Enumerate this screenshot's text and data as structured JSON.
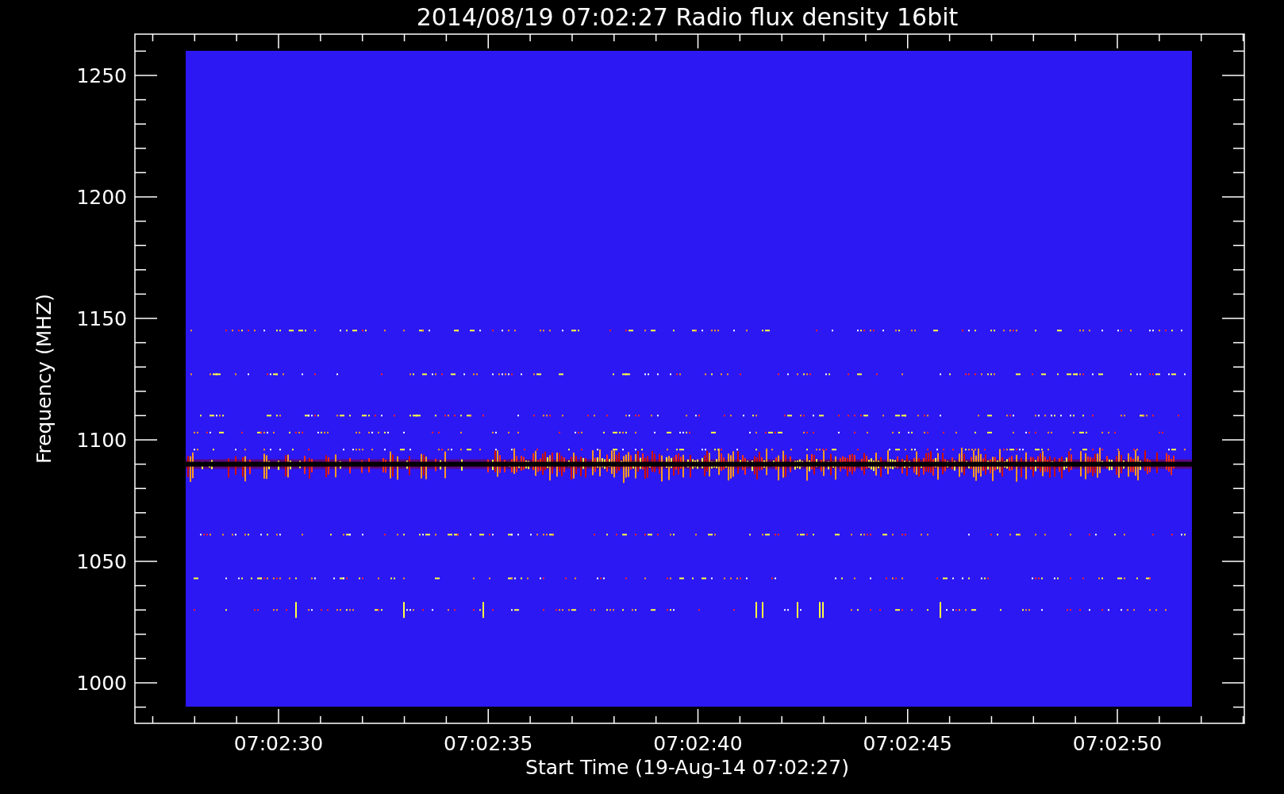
{
  "title": "2014/08/19 07:02:27 Radio flux density 16bit",
  "ylabel": "Frequency (MHZ)",
  "xlabel": "Start Time (19-Aug-14 07:02:27)",
  "yticks": [
    "1250",
    "1200",
    "1150",
    "1100",
    "1050",
    "1000"
  ],
  "xticks": [
    "07:02:30",
    "07:02:35",
    "07:02:40",
    "07:02:45",
    "07:02:50"
  ]
}
